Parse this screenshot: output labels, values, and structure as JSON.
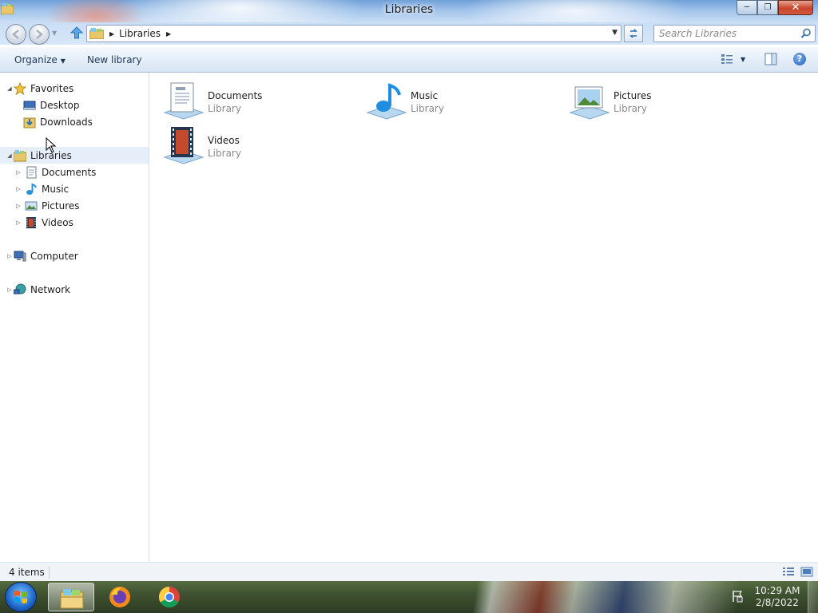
{
  "window": {
    "title": "Libraries"
  },
  "address": {
    "crumbs": [
      "Libraries"
    ]
  },
  "search": {
    "placeholder": "Search Libraries"
  },
  "toolbar": {
    "organize_label": "Organize",
    "new_library_label": "New library"
  },
  "navpane": {
    "favorites": {
      "label": "Favorites",
      "items": [
        {
          "label": "Desktop",
          "icon": "desktop-icon"
        },
        {
          "label": "Downloads",
          "icon": "downloads-icon"
        }
      ]
    },
    "libraries": {
      "label": "Libraries",
      "items": [
        {
          "label": "Documents",
          "icon": "documents-icon"
        },
        {
          "label": "Music",
          "icon": "music-icon"
        },
        {
          "label": "Pictures",
          "icon": "pictures-icon"
        },
        {
          "label": "Videos",
          "icon": "videos-icon"
        }
      ]
    },
    "computer": {
      "label": "Computer"
    },
    "network": {
      "label": "Network"
    }
  },
  "content": {
    "items": [
      {
        "name": "Documents",
        "type": "Library",
        "icon": "documents-library-icon"
      },
      {
        "name": "Music",
        "type": "Library",
        "icon": "music-library-icon"
      },
      {
        "name": "Pictures",
        "type": "Library",
        "icon": "pictures-library-icon"
      },
      {
        "name": "Videos",
        "type": "Library",
        "icon": "videos-library-icon"
      }
    ]
  },
  "status": {
    "item_count": "4 items"
  },
  "taskbar": {
    "apps": [
      "windows-explorer-icon",
      "firefox-icon",
      "chrome-icon"
    ]
  },
  "clock": {
    "time": "10:29 AM",
    "date": "2/8/2022"
  },
  "colors": {
    "accent": "#1e395b",
    "selection": "#e5eef9",
    "secondary_text": "#8a8a8a"
  }
}
